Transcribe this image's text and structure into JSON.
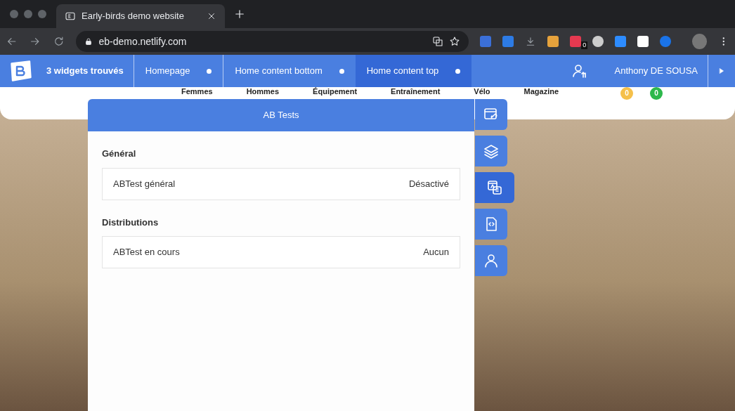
{
  "browser": {
    "tab_title": "Early-birds demo website",
    "address": "eb-demo.netlify.com",
    "extension_badge": "0"
  },
  "toolbar": {
    "widgets_found": "3 widgets trouvés",
    "widgets": [
      {
        "label": "Homepage",
        "selected": false
      },
      {
        "label": "Home content bottom",
        "selected": false
      },
      {
        "label": "Home content top",
        "selected": true
      }
    ],
    "user": "Anthony DE SOUSA"
  },
  "site": {
    "nav": [
      "Femmes",
      "Hommes",
      "Équipement",
      "Entraînement",
      "Vélo",
      "Magazine"
    ],
    "badges": [
      {
        "text": "0",
        "color": "#f5c04a"
      },
      {
        "text": "0",
        "color": "#2db84b"
      }
    ]
  },
  "panel": {
    "title": "AB Tests",
    "sections": [
      {
        "heading": "Général",
        "rows": [
          {
            "label": "ABTest général",
            "value": "Désactivé"
          }
        ]
      },
      {
        "heading": "Distributions",
        "rows": [
          {
            "label": "ABTest en cours",
            "value": "Aucun"
          }
        ]
      }
    ]
  },
  "side_buttons": [
    {
      "kind": "link",
      "selected": false
    },
    {
      "kind": "layers",
      "selected": false
    },
    {
      "kind": "abtest",
      "selected": true
    },
    {
      "kind": "code",
      "selected": false
    },
    {
      "kind": "user",
      "selected": false
    }
  ]
}
